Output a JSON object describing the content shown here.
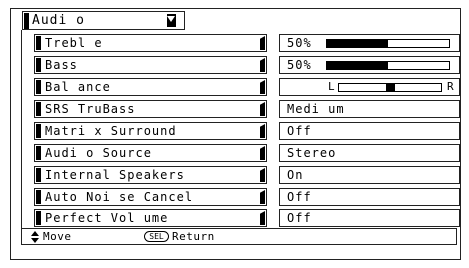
{
  "menu": {
    "title": "Audi o"
  },
  "rows": [
    {
      "label": "Trebl e",
      "value": "50%",
      "type": "bar",
      "level": 0.5
    },
    {
      "label": "Bass",
      "value": "50%",
      "type": "bar",
      "level": 0.5
    },
    {
      "label": "Bal ance",
      "type": "balance",
      "left_label": "L",
      "right_label": "R",
      "position": 0.5
    },
    {
      "label": "SRS TruBass",
      "value": "Medi um",
      "type": "text"
    },
    {
      "label": "Matri x Surround",
      "value": "Off",
      "type": "text"
    },
    {
      "label": "Audi o Source",
      "value": "Stereo",
      "type": "text"
    },
    {
      "label": "Internal  Speakers",
      "value": "On",
      "type": "text"
    },
    {
      "label": "Auto Noi se Cancel",
      "value": "Off",
      "type": "text"
    },
    {
      "label": "Perfect Vol ume",
      "value": "Off",
      "type": "text"
    }
  ],
  "footer": {
    "move_label": "Move",
    "sel_key": "SEL",
    "return_label": "Return",
    "move_icon": "up-down-arrows-icon"
  }
}
